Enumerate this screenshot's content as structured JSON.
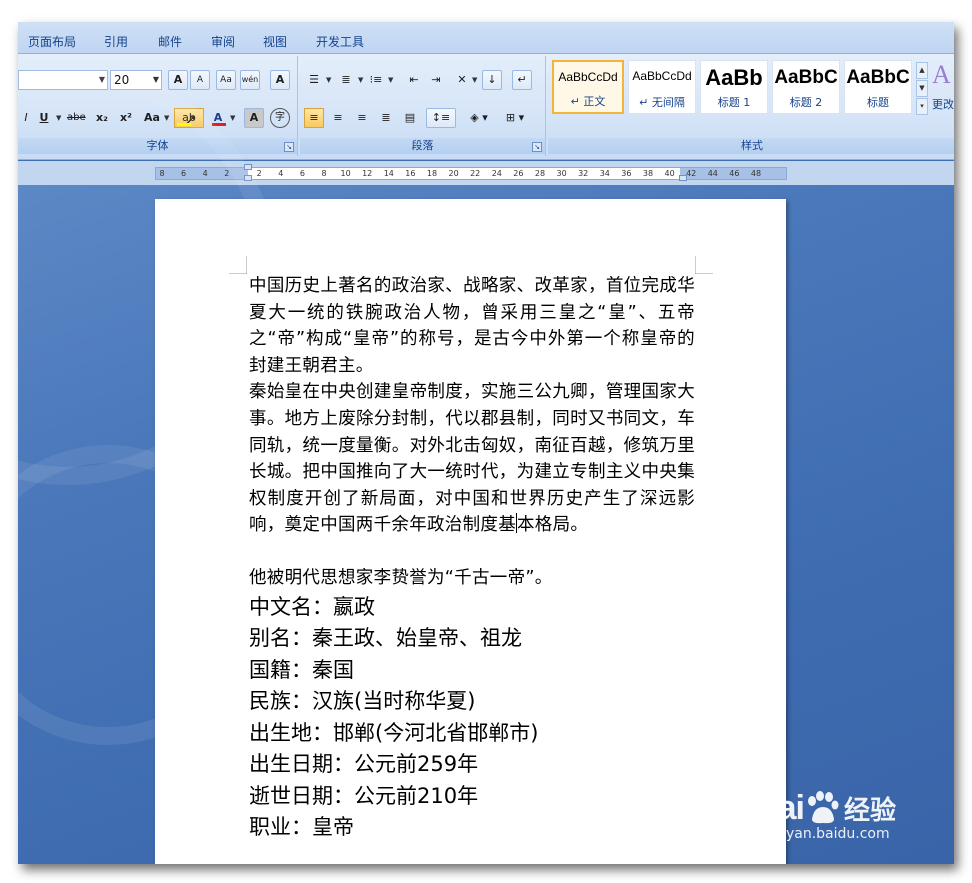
{
  "ribbon_tabs": [
    "页面布局",
    "引用",
    "邮件",
    "审阅",
    "视图",
    "开发工具"
  ],
  "font_group": {
    "label": "字体",
    "font_size": "20",
    "buttons": {
      "grow": "A",
      "shrink": "A",
      "clear": "Aa",
      "phonetic": "wén",
      "border_char": "A",
      "underline": "U",
      "strike": "abe",
      "subscript": "x₂",
      "superscript": "x²",
      "change_case": "Aa",
      "highlight": "ab",
      "font_color": "A",
      "shading_char": "A",
      "enclose": "字"
    }
  },
  "paragraph_group": {
    "label": "段落"
  },
  "styles_group": {
    "label": "样式",
    "items": [
      {
        "sample": "AaBbCcDd",
        "name": "↵ 正文"
      },
      {
        "sample": "AaBbCcDd",
        "name": "↵ 无间隔"
      },
      {
        "sample": "AaBb",
        "name": "标题 1"
      },
      {
        "sample": "AaBbC",
        "name": "标题 2"
      },
      {
        "sample": "AaBbC",
        "name": "标题"
      }
    ],
    "change_styles": "更改"
  },
  "ruler": {
    "ticks": [
      "8",
      "6",
      "4",
      "2",
      "2",
      "4",
      "6",
      "8",
      "10",
      "12",
      "14",
      "16",
      "18",
      "20",
      "22",
      "24",
      "26",
      "28",
      "30",
      "32",
      "34",
      "36",
      "38",
      "40",
      "42",
      "44",
      "46",
      "48"
    ]
  },
  "document": {
    "para1": "中国历史上著名的政治家、战略家、改革家，首位完成华夏大一统的铁腕政治人物，曾采用三皇之“皇”、五帝之“帝”构成“皇帝”的称号，是古今中外第一个称皇帝的封建王朝君主。",
    "para2_before_cursor": "秦始皇在中央创建皇帝制度，实施三公九卿，管理国家大事。地方上废除分封制，代以郡县制，同时又书同文，车同轨，统一度量衡。对外北击匈奴，南征百越，修筑万里长城。把中国推向了大一统时代，为建立专制主义中央集权制度开创了新局面，对中国和世界历史产生了深远影响，奠定中国两千余年政治制度基",
    "para2_after_cursor": "本格局。",
    "para3": "他被明代思想家李贽誉为“千古一帝”。",
    "info_lines": [
      "中文名：嬴政",
      "别名：秦王政、始皇帝、祖龙",
      "国籍：秦国",
      "民族：汉族(当时称华夏)",
      "出生地：邯郸(今河北省邯郸市)",
      "出生日期：公元前259年",
      "逝世日期：公元前210年",
      "职业：皇帝"
    ]
  },
  "watermark": {
    "logo_left": "Bai",
    "logo_right": "经验",
    "url": "jingyan.baidu.com"
  },
  "colors": {
    "ribbon_text": "#15428b",
    "doc_background": "#4a78ba",
    "selected_style_border": "#f2b53a",
    "font_color_bar": "#e02020",
    "highlight_bar": "#ffff00"
  }
}
